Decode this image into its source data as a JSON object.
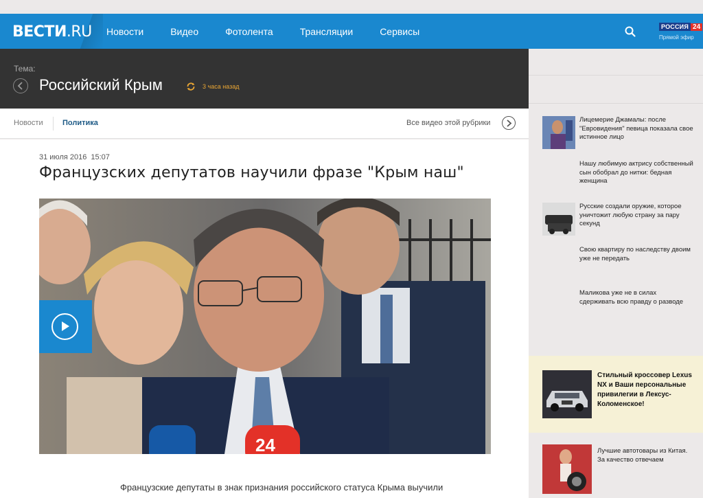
{
  "header": {
    "logo_main": "ВЕСТИ",
    "logo_suffix": ".RU",
    "nav": [
      "Новости",
      "Видео",
      "Фотолента",
      "Трансляции",
      "Сервисы"
    ],
    "channel_badge_name": "РОССИЯ",
    "channel_badge_num": "24",
    "channel_live": "Прямой эфир",
    "brand_color": "#1a88cf"
  },
  "theme": {
    "label": "Тема:",
    "title": "Российский Крым",
    "updated": "3 часа назад"
  },
  "subnav": {
    "crumb_news": "Новости",
    "crumb_politics": "Политика",
    "all_videos": "Все видео этой рубрики"
  },
  "article": {
    "date": "31 июля 2016",
    "time": "15:07",
    "headline": "Французских депутатов научили фразе \"Крым наш\"",
    "lead": "Французские депутаты в знак признания российского статуса Крыма выучили"
  },
  "sidebar": {
    "news": [
      "Лицемерие Джамалы: после \"Евровидения\" певица показала свое истинное лицо",
      "Нашу любимую актрису собственный сын обобрал до нитки: бедная женщина",
      "Русские создали оружие, которое уничтожит любую страну за пару секунд",
      "Свою квартиру по наследству двоим уже не передать",
      "Маликова уже не в силах сдерживать всю правду о разводе"
    ],
    "promo": "Стильный кроссовер Lexus NX и Ваши персональные привилегии в Лексус-Коломенское!",
    "bottom": "Лучшие автотовары из Китая. За качество отвечаем"
  }
}
